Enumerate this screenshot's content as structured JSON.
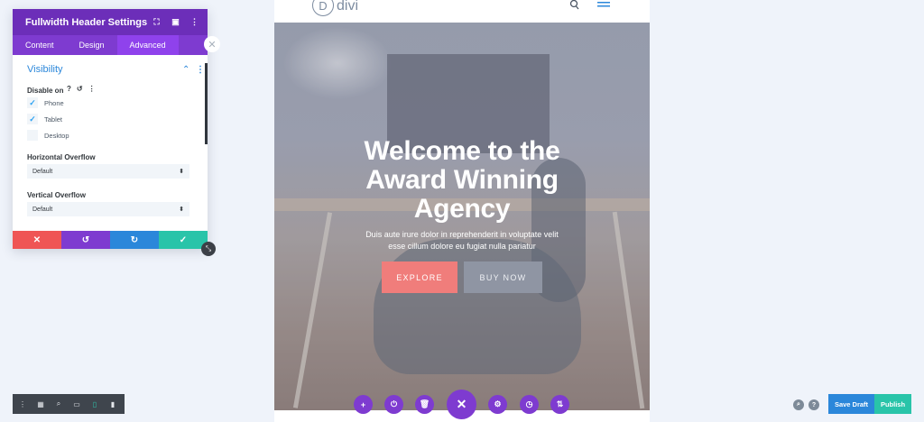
{
  "site": {
    "logo_letter": "D",
    "logo_text": "divi"
  },
  "hero": {
    "headline": [
      "Welcome to the",
      "Award Winning",
      "Agency"
    ],
    "subtext": [
      "Duis aute irure dolor in reprehenderit in voluptate velit",
      "esse cillum dolore eu fugiat nulla pariatur"
    ],
    "explore_label": "EXPLORE",
    "buy_label": "BUY NOW"
  },
  "panel": {
    "title": "Fullwidth Header Settings",
    "tabs": [
      "Content",
      "Design",
      "Advanced"
    ],
    "active_tab": "Advanced",
    "section_title": "Visibility",
    "disable_on_label": "Disable on",
    "devices": [
      {
        "label": "Phone",
        "checked": true
      },
      {
        "label": "Tablet",
        "checked": true
      },
      {
        "label": "Desktop",
        "checked": false
      }
    ],
    "horizontal_overflow_label": "Horizontal Overflow",
    "horizontal_overflow_value": "Default",
    "vertical_overflow_label": "Vertical Overflow",
    "vertical_overflow_value": "Default"
  },
  "footer": {
    "save_draft": "Save Draft",
    "publish": "Publish"
  },
  "colors": {
    "panel_header": "#6c2eb9",
    "panel_tabs": "#7e3bd0",
    "accent_blue": "#2b87da",
    "cancel_red": "#ef5555",
    "undo_purple": "#7e3bd0",
    "redo_blue": "#2b87da",
    "save_green": "#29c4a9",
    "explore_coral": "#f07d7b"
  }
}
